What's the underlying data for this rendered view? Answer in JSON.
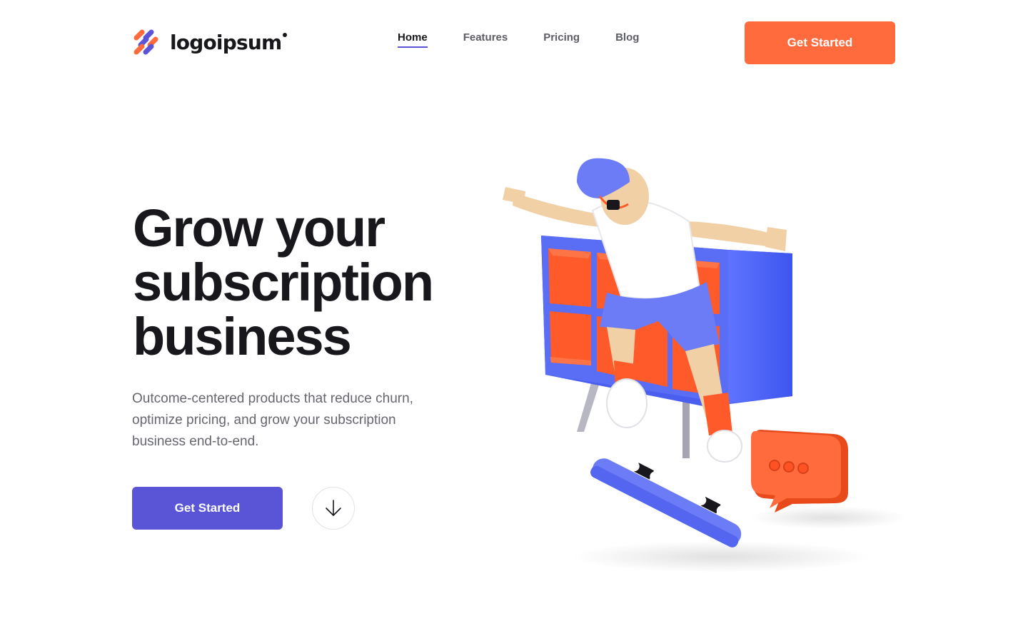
{
  "brand": {
    "name": "logoipsum",
    "colors": {
      "orange": "#ff6b3c",
      "purple": "#5a55d6",
      "blue": "#4a5ff0"
    }
  },
  "nav": {
    "items": [
      {
        "label": "Home",
        "active": true
      },
      {
        "label": "Features",
        "active": false
      },
      {
        "label": "Pricing",
        "active": false
      },
      {
        "label": "Blog",
        "active": false
      }
    ]
  },
  "header": {
    "cta_label": "Get Started"
  },
  "hero": {
    "title_line1": "Grow your",
    "title_line2": "subscription",
    "title_line3": "business",
    "subtitle": "Outcome-centered products that reduce churn, optimize pricing, and grow your subscription business end-to-end.",
    "cta_label": "Get Started",
    "scroll_icon": "arrow-down-icon"
  },
  "illustration": {
    "name": "skater-3d-illustration",
    "chat_icon": "chat-bubble-icon"
  }
}
